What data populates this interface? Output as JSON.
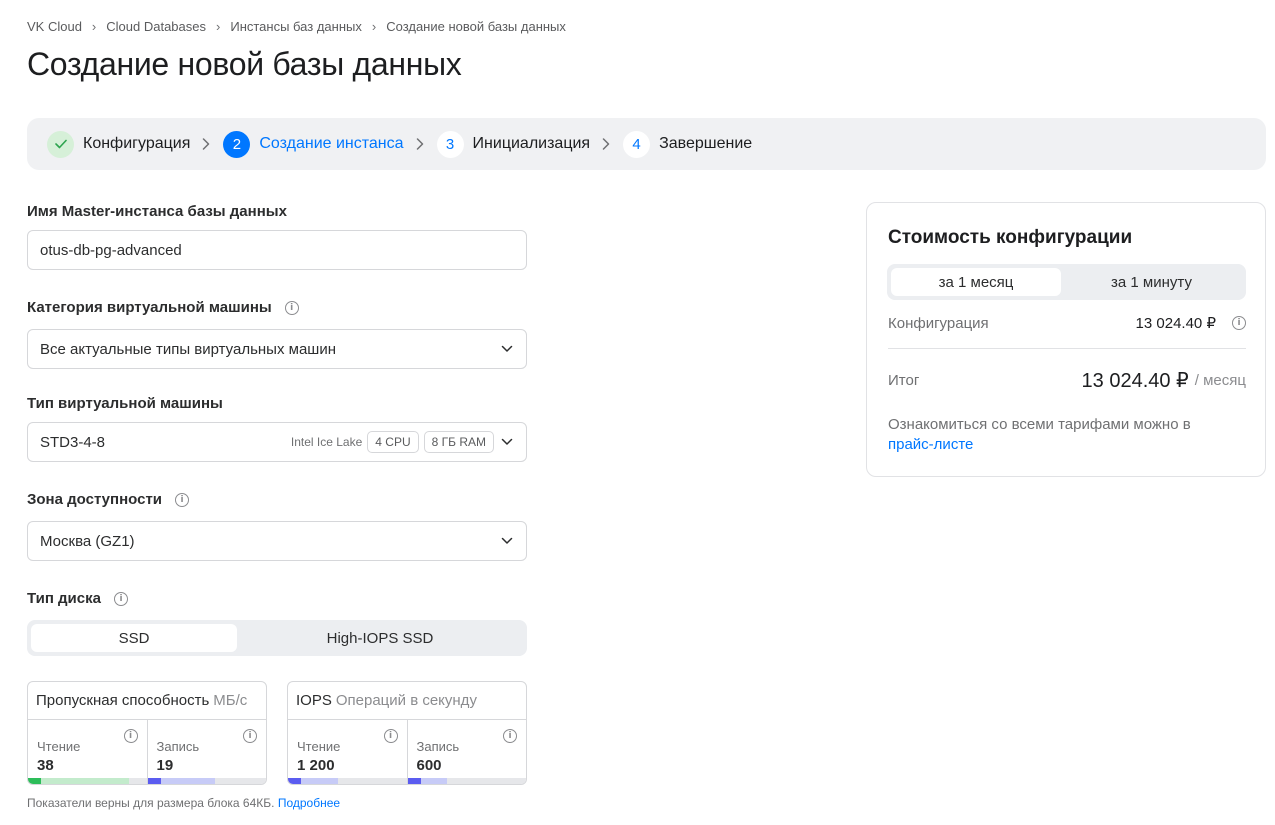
{
  "breadcrumb": {
    "items": [
      "VK Cloud",
      "Cloud Databases",
      "Инстансы баз данных",
      "Создание новой базы данных"
    ]
  },
  "page": {
    "title": "Создание новой базы данных"
  },
  "stepper": {
    "steps": [
      {
        "number": "✓",
        "label": "Конфигурация",
        "state": "done"
      },
      {
        "number": "2",
        "label": "Создание инстанса",
        "state": "active"
      },
      {
        "number": "3",
        "label": "Инициализация",
        "state": "todo"
      },
      {
        "number": "4",
        "label": "Завершение",
        "state": "todo"
      }
    ]
  },
  "form": {
    "instance_name": {
      "label": "Имя Master-инстанса базы данных",
      "value": "otus-db-pg-advanced"
    },
    "vm_category": {
      "label": "Категория виртуальной машины",
      "value": "Все актуальные типы виртуальных машин"
    },
    "vm_type": {
      "label": "Тип виртуальной машины",
      "value": "STD3-4-8",
      "cpu_family": "Intel Ice Lake",
      "cpu_chip": "4 CPU",
      "ram_chip": "8 ГБ RAM"
    },
    "zone": {
      "label": "Зона доступности",
      "value": "Москва (GZ1)"
    },
    "disk_type": {
      "label": "Тип диска",
      "options": [
        "SSD",
        "High-IOPS SSD"
      ],
      "selected": "SSD"
    },
    "throughput": {
      "title": "Пропускная способность",
      "unit": "МБ/с",
      "read_label": "Чтение",
      "read_value": "38",
      "write_label": "Запись",
      "write_value": "19",
      "read_fill": 0.85,
      "write_fill": 0.57
    },
    "iops": {
      "title": "IOPS",
      "unit": "Операций в секунду",
      "read_label": "Чтение",
      "read_value": "1 200",
      "write_label": "Запись",
      "write_value": "600",
      "read_fill": 0.42,
      "write_fill": 0.33
    },
    "footnote": {
      "text": "Показатели верны для размера блока 64КБ.",
      "link": "Подробнее"
    }
  },
  "cost": {
    "title": "Стоимость конфигурации",
    "period_options": [
      "за 1 месяц",
      "за 1 минуту"
    ],
    "selected_period": "за 1 месяц",
    "config_label": "Конфигурация",
    "config_value": "13 024.40 ₽",
    "total_label": "Итог",
    "total_value": "13 024.40 ₽",
    "total_unit": "/ месяц",
    "note_text": "Ознакомиться со всеми тарифами можно в",
    "note_link": "прайс-листе"
  },
  "colors": {
    "accent": "#0077ff",
    "done_green": "#2ea44f",
    "bar_green_strong": "#2dbd5a",
    "bar_green_light": "#c3ebcc",
    "bar_blue_strong": "#5b5cf0",
    "bar_blue_light": "#c7cbf7"
  }
}
